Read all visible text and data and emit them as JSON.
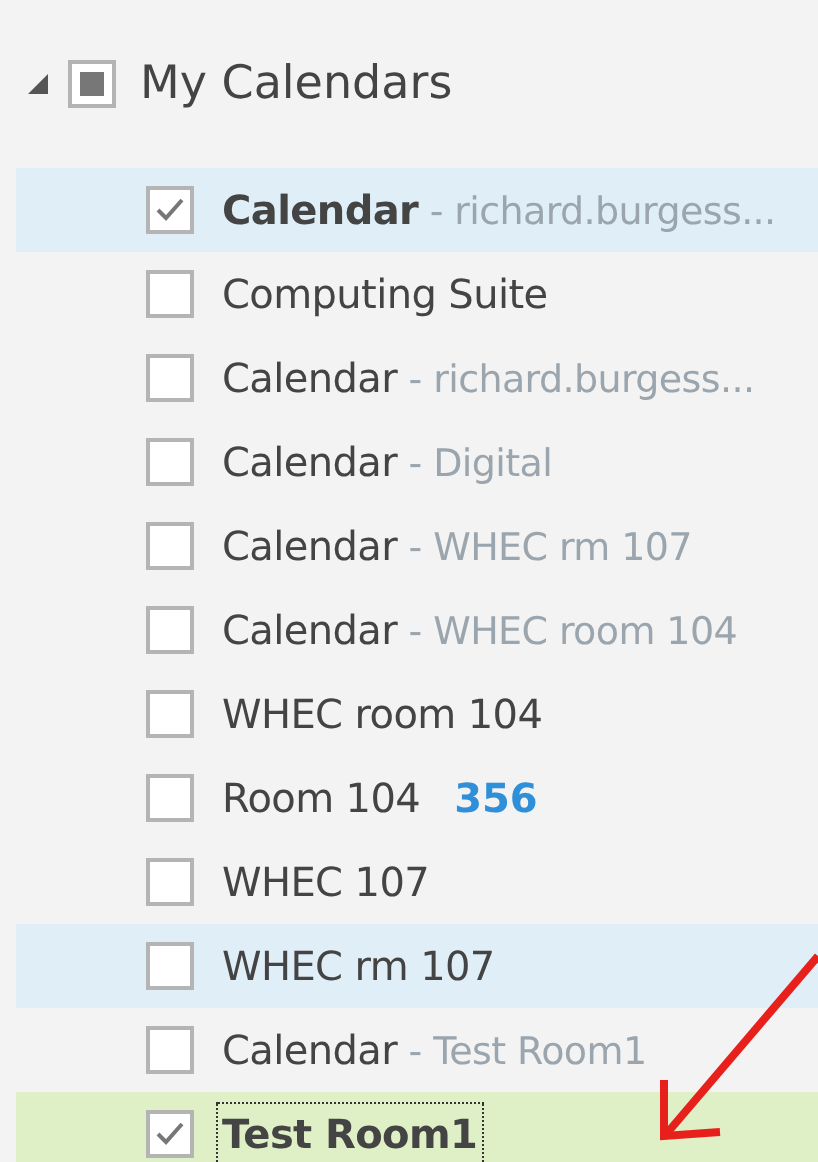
{
  "group": {
    "label": "My Calendars",
    "expanded": true,
    "partial": true
  },
  "calendars": [
    {
      "name": "Calendar",
      "detail": "- richard.burgess...",
      "checked": true,
      "selected": true,
      "focused": false
    },
    {
      "name": "Computing Suite",
      "checked": false,
      "selected": false,
      "focused": false
    },
    {
      "name": "Calendar",
      "detail": "- richard.burgess...",
      "checked": false,
      "selected": false,
      "focused": false
    },
    {
      "name": "Calendar",
      "detail": "- Digital",
      "checked": false,
      "selected": false,
      "focused": false
    },
    {
      "name": "Calendar",
      "detail": "- WHEC rm 107",
      "checked": false,
      "selected": false,
      "focused": false
    },
    {
      "name": "Calendar",
      "detail": "- WHEC room 104",
      "checked": false,
      "selected": false,
      "focused": false
    },
    {
      "name": "WHEC room 104",
      "checked": false,
      "selected": false,
      "focused": false
    },
    {
      "name": "Room 104",
      "count": "356",
      "checked": false,
      "selected": false,
      "focused": false
    },
    {
      "name": "WHEC 107",
      "checked": false,
      "selected": false,
      "focused": false
    },
    {
      "name": "WHEC rm 107",
      "checked": false,
      "selected": true,
      "focused": false
    },
    {
      "name": "Calendar",
      "detail": "- Test Room1",
      "checked": false,
      "selected": false,
      "focused": false
    },
    {
      "name": "Test Room1",
      "checked": true,
      "selected": true,
      "focused": true
    }
  ]
}
